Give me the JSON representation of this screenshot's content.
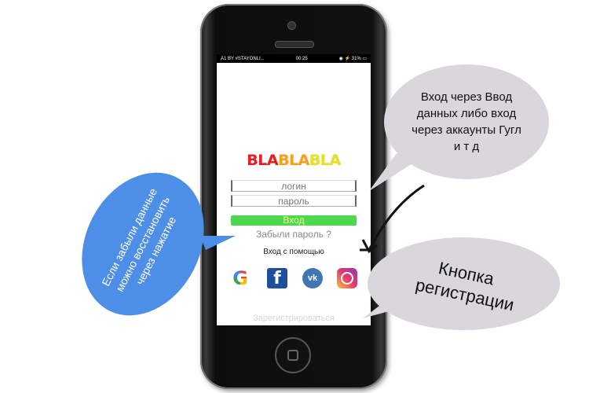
{
  "statusbar": {
    "carrier": "A1 BY #STAYONLI...",
    "time": "00:25",
    "battery": "31%"
  },
  "logo": {
    "parts": [
      "BLA",
      "BLA",
      "BLA"
    ],
    "colors": [
      "#e62020",
      "#f3a21c",
      "#e7e21f"
    ]
  },
  "form": {
    "login_placeholder": "логин",
    "password_placeholder": "пароль",
    "login_button": "Вход",
    "forgot_password": "Забыли пароль ?",
    "login_via": "Вход с помощью",
    "register": "Зарегистрироваться"
  },
  "social": [
    {
      "name": "google",
      "label": "G",
      "color": "#ea4335"
    },
    {
      "name": "facebook",
      "label": "f",
      "color": "#1e4f9c"
    },
    {
      "name": "vk",
      "label": "vk",
      "color": "#3f76b5"
    },
    {
      "name": "instagram",
      "label": "",
      "color": "#e63a6a"
    }
  ],
  "annotations": {
    "social_login_note": "Вход  через Ввод данных либо вход через аккаунты Гугл и т д",
    "register_note": "Кнопка регистрации",
    "forgot_note": "Если забыли данные можно восстановить через нажатие"
  }
}
